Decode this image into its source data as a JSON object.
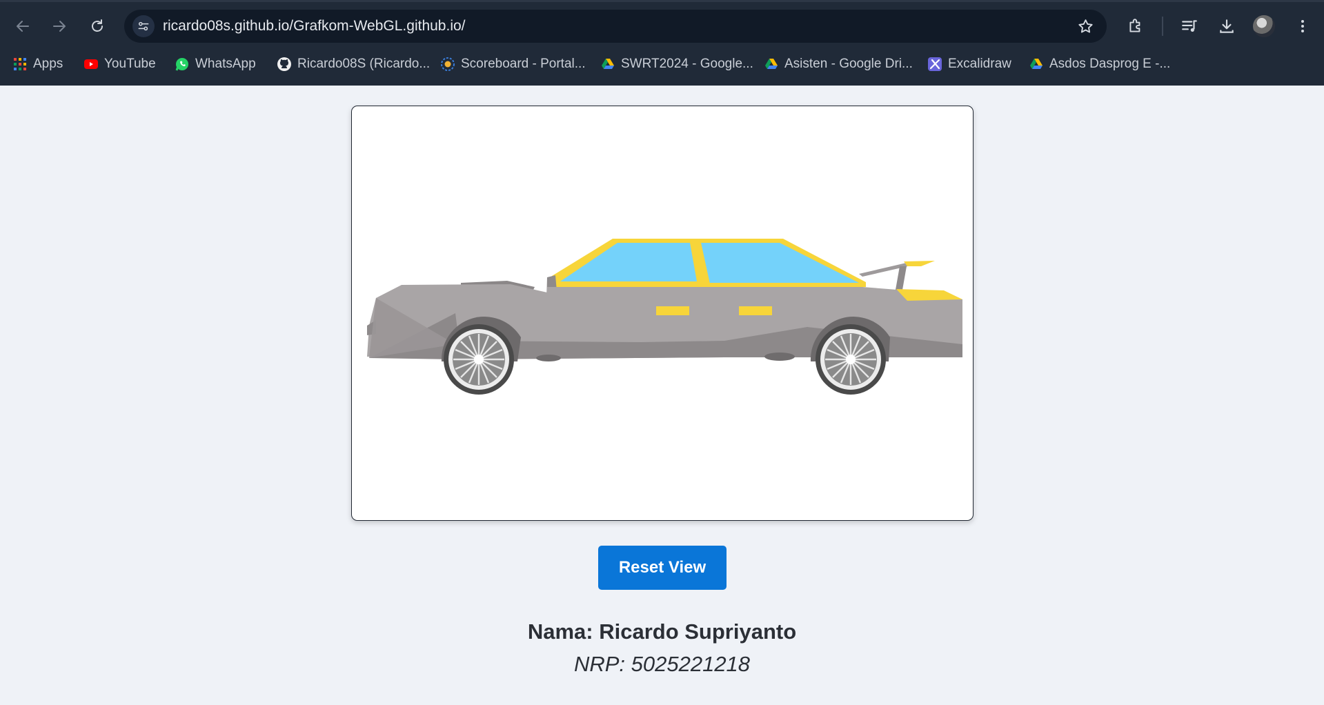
{
  "browser": {
    "url": "ricardo08s.github.io/Grafkom-WebGL.github.io/",
    "bookmarks": [
      {
        "label": "Apps",
        "icon": "apps-grid-icon"
      },
      {
        "label": "YouTube",
        "icon": "youtube-icon"
      },
      {
        "label": "WhatsApp",
        "icon": "whatsapp-icon"
      },
      {
        "label": "Ricardo08S (Ricardo...",
        "icon": "github-icon"
      },
      {
        "label": "Scoreboard - Portal...",
        "icon": "portal-icon"
      },
      {
        "label": "SWRT2024 - Google...",
        "icon": "google-drive-icon"
      },
      {
        "label": "Asisten - Google Dri...",
        "icon": "google-drive-icon"
      },
      {
        "label": "Excalidraw",
        "icon": "excalidraw-icon"
      },
      {
        "label": "Asdos Dasprog E -...",
        "icon": "google-drive-icon"
      }
    ],
    "colors": {
      "frame": "#202a38",
      "omnibox": "#111a27"
    }
  },
  "page": {
    "reset_label": "Reset View",
    "name_text": "Nama: Ricardo Supriyanto",
    "nrp_text": "NRP: 5025221218",
    "colors": {
      "background": "#eff2f7",
      "button": "#0a76d8",
      "car_body": "#a9a5a6",
      "car_glass": "#74d2fa",
      "car_trim": "#f7d53a"
    }
  }
}
